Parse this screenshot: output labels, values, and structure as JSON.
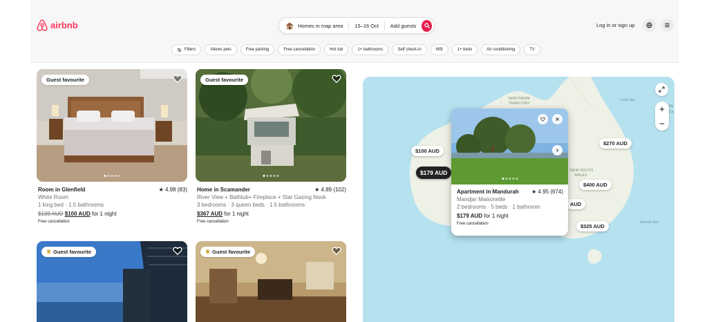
{
  "brand": {
    "name": "airbnb",
    "color": "#ff385c"
  },
  "search": {
    "location": "Homes in map area",
    "dates": "15–16 Oct",
    "guests": "Add guests"
  },
  "header": {
    "login": "Log in or sign up"
  },
  "filters": [
    "Filters",
    "Allows pets",
    "Free parking",
    "Free cancellation",
    "Hot tub",
    "1+ bathrooms",
    "Self check-in",
    "Wifi",
    "1+ beds",
    "Air conditioning",
    "TV"
  ],
  "listings": [
    {
      "badge": "Guest favourite",
      "title": "Room in Glenfield",
      "rating": "★ 4.98 (83)",
      "subtitle": "White Room",
      "details": "1 king bed · 1.5 bathrooms",
      "old_price": "$139 AUD",
      "price": "$100 AUD",
      "price_suffix": "for 1 night",
      "free": "Free cancellation"
    },
    {
      "badge": "Guest favourite",
      "title": "Home in Scamander",
      "rating": "★ 4.89 (102)",
      "subtitle": "River View + Bathtub+ Fireplace + Star Gazing Nook",
      "details": "3 bedrooms · 3 queen beds · 1.5 bathrooms",
      "price": "$367 AUD",
      "price_suffix": "for 1 night",
      "free": "Free cancellation"
    },
    {
      "badge": "Guest favourite"
    },
    {
      "badge": "Guest favourite"
    }
  ],
  "map": {
    "pins": [
      "$100 AUD",
      "$179 AUD",
      "$270 AUD",
      "$400 AUD",
      "$325 AUD",
      "AUD"
    ],
    "selected_pin": "$179 AUD",
    "labels": {
      "northern": "NORTHERN",
      "territory": "TERRITORY",
      "nsw1": "NEW SOUTH",
      "nsw2": "WALES",
      "coral_sea": "Coral Sea",
      "tasman_sea": "Tasman Sea",
      "ne": "Ne",
      "ca": "Ca"
    },
    "popup": {
      "title": "Apartment in Mandurah",
      "rating": "★ 4.95 (674)",
      "subtitle": "Mandjar Maisonette",
      "details": "2 bedrooms · 5 beds · 1 bathroom",
      "price": "$179 AUD",
      "price_suffix": "for 1 night",
      "free": "Free cancellation"
    }
  }
}
